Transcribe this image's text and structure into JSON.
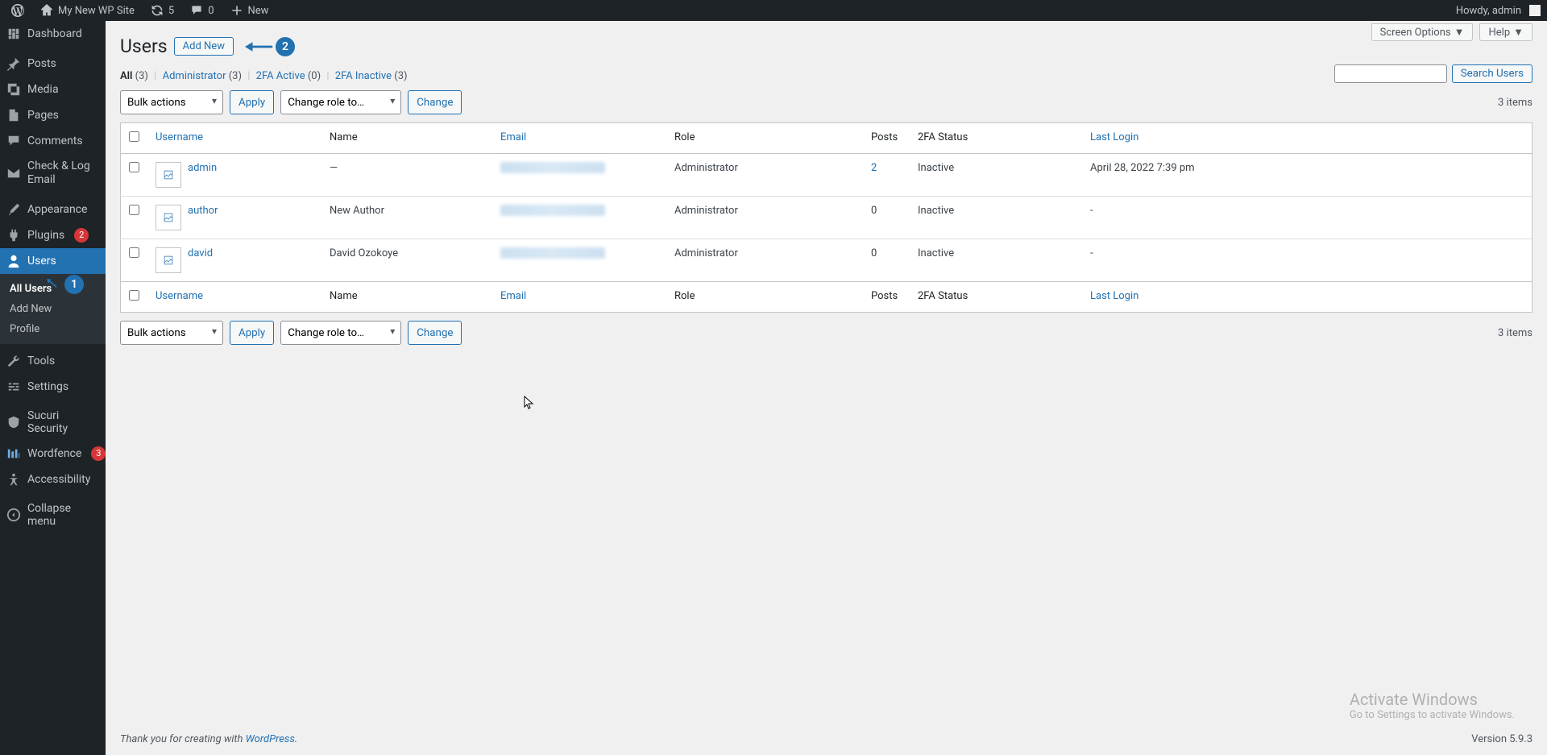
{
  "adminbar": {
    "site_name": "My New WP Site",
    "refresh_count": "5",
    "comments_count": "0",
    "new_label": "New",
    "howdy": "Howdy, admin"
  },
  "sidebar": {
    "items": [
      {
        "label": "Dashboard",
        "icon": "dashboard"
      },
      {
        "label": "Posts",
        "icon": "pin"
      },
      {
        "label": "Media",
        "icon": "media"
      },
      {
        "label": "Pages",
        "icon": "pages"
      },
      {
        "label": "Comments",
        "icon": "comment"
      },
      {
        "label": "Check & Log Email",
        "icon": "mail"
      },
      {
        "label": "Appearance",
        "icon": "brush"
      },
      {
        "label": "Plugins",
        "icon": "plug",
        "badge": "2"
      },
      {
        "label": "Users",
        "icon": "user",
        "current": true
      },
      {
        "label": "Tools",
        "icon": "wrench"
      },
      {
        "label": "Settings",
        "icon": "sliders"
      },
      {
        "label": "Sucuri Security",
        "icon": "shield"
      },
      {
        "label": "Wordfence",
        "icon": "wordfence",
        "badge": "3"
      },
      {
        "label": "Accessibility",
        "icon": "accessibility"
      },
      {
        "label": "Collapse menu",
        "icon": "collapse"
      }
    ],
    "submenu": [
      {
        "label": "All Users",
        "current": true
      },
      {
        "label": "Add New"
      },
      {
        "label": "Profile"
      }
    ]
  },
  "page": {
    "title": "Users",
    "add_new": "Add New",
    "screen_options": "Screen Options",
    "help": "Help"
  },
  "filters": {
    "all": "All",
    "all_count": "(3)",
    "admin": "Administrator",
    "admin_count": "(3)",
    "tfa_active": "2FA Active",
    "tfa_active_count": "(0)",
    "tfa_inactive": "2FA Inactive",
    "tfa_inactive_count": "(3)"
  },
  "search": {
    "button": "Search Users"
  },
  "bulk": {
    "actions": "Bulk actions",
    "apply": "Apply",
    "role": "Change role to…",
    "change": "Change"
  },
  "items_count": "3 items",
  "columns": {
    "username": "Username",
    "name": "Name",
    "email": "Email",
    "role": "Role",
    "posts": "Posts",
    "tfa": "2FA Status",
    "login": "Last Login"
  },
  "rows": [
    {
      "username": "admin",
      "name": "—",
      "role": "Administrator",
      "posts": "2",
      "posts_link": true,
      "tfa": "Inactive",
      "login": "April 28, 2022 7:39 pm"
    },
    {
      "username": "author",
      "name": "New Author",
      "role": "Administrator",
      "posts": "0",
      "tfa": "Inactive",
      "login": "-"
    },
    {
      "username": "david",
      "name": "David Ozokoye",
      "role": "Administrator",
      "posts": "0",
      "tfa": "Inactive",
      "login": "-"
    }
  ],
  "footer": {
    "thank": "Thank you for creating with ",
    "wp": "WordPress",
    "dot": ".",
    "version": "Version 5.9.3"
  },
  "activate": {
    "title": "Activate Windows",
    "sub": "Go to Settings to activate Windows."
  },
  "annotations": {
    "one": "1",
    "two": "2"
  }
}
